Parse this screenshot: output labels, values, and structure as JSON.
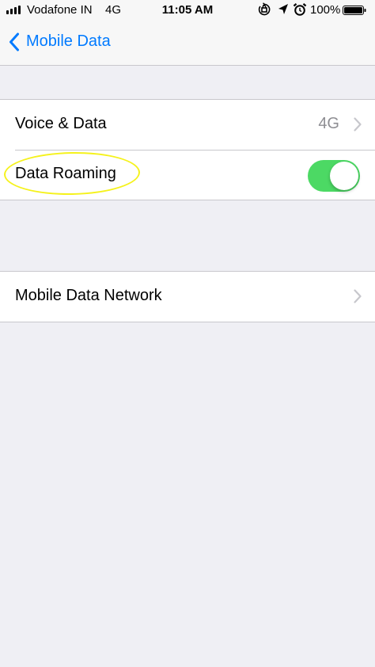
{
  "status_bar": {
    "carrier": "Vodafone IN",
    "network": "4G",
    "time": "11:05 AM",
    "battery_percent": "100%",
    "icons": [
      "signal-bars-icon",
      "orientation-lock-icon",
      "location-arrow-icon",
      "alarm-clock-icon",
      "battery-icon"
    ]
  },
  "nav": {
    "back_label": "Mobile Data",
    "back_icon": "chevron-left-icon",
    "tint_color": "#007aff"
  },
  "group1": {
    "rows": [
      {
        "label": "Voice & Data",
        "value": "4G",
        "accessory": "chevron-right-icon"
      },
      {
        "label": "Data Roaming",
        "toggle_on": true,
        "accessory": "toggle-switch"
      }
    ]
  },
  "group2": {
    "rows": [
      {
        "label": "Mobile Data Network",
        "accessory": "chevron-right-icon"
      }
    ]
  },
  "colors": {
    "background": "#efeff4",
    "toggle_on": "#4cd964",
    "secondary_text": "#8e8e93",
    "highlight_annotation": "#f5f21c"
  }
}
